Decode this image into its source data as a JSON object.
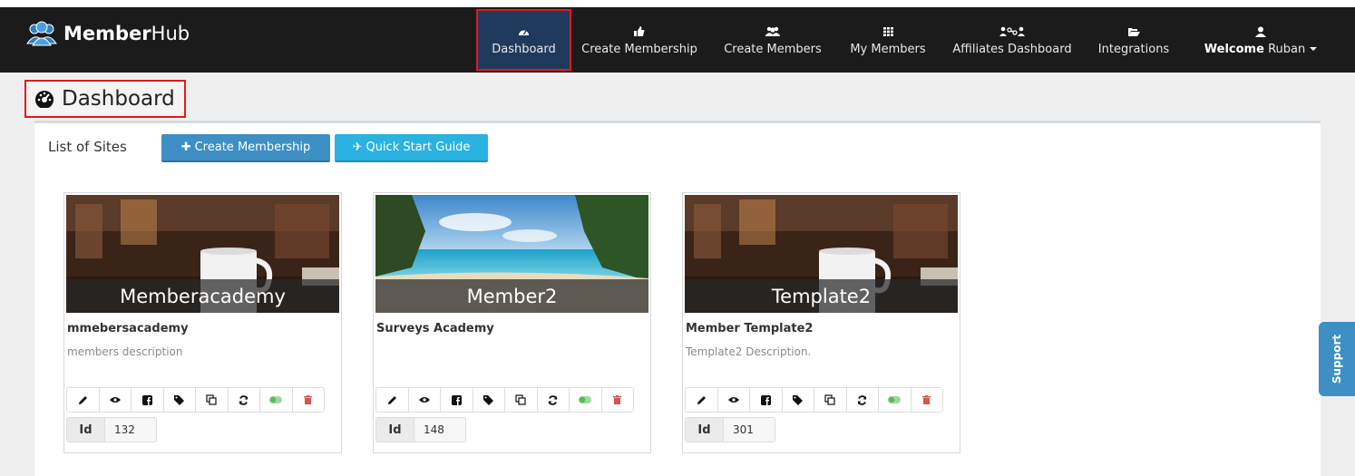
{
  "brand": {
    "name_bold": "Member",
    "name_rest": "Hub"
  },
  "nav": [
    {
      "label": "Dashboard",
      "icon": "dashboard-icon",
      "active": true
    },
    {
      "label": "Create Membership",
      "icon": "thumbs-up-icon"
    },
    {
      "label": "Create Members",
      "icon": "users-icon"
    },
    {
      "label": "My Members",
      "icon": "grid-icon"
    },
    {
      "label": "Affiliates Dashboard",
      "icon": "affiliates-icon"
    },
    {
      "label": "Integrations",
      "icon": "folder-open-icon"
    }
  ],
  "user": {
    "welcome": "Welcome",
    "name": "Ruban",
    "icon": "user-icon"
  },
  "page": {
    "title": "Dashboard",
    "icon": "dashboard-icon"
  },
  "panel": {
    "list_label": "List of Sites",
    "create_button": "Create Membership",
    "guide_button": "Quick Start Guide"
  },
  "sites": [
    {
      "caption": "Memberacademy",
      "name": "mmebersacademy",
      "description": "members description",
      "id_label": "Id",
      "id": "132",
      "image": "coffee-cup"
    },
    {
      "caption": "Member2",
      "name": "Surveys Academy",
      "description": "",
      "id_label": "Id",
      "id": "148",
      "image": "beach"
    },
    {
      "caption": "Template2",
      "name": "Member Template2",
      "description": "Template2 Description.",
      "id_label": "Id",
      "id": "301",
      "image": "coffee-cup"
    }
  ],
  "card_actions": [
    "edit-icon",
    "view-icon",
    "facebook-icon",
    "tags-icon",
    "copy-icon",
    "refresh-icon",
    "toggle-icon",
    "delete-icon"
  ],
  "support_label": "Support",
  "colors": {
    "navbar": "#1b1b1b",
    "primary": "#3d8fc4",
    "info": "#2ab2e0",
    "highlight": "#e21b1b",
    "toggle": "#5cb85c",
    "delete": "#d9534f"
  }
}
